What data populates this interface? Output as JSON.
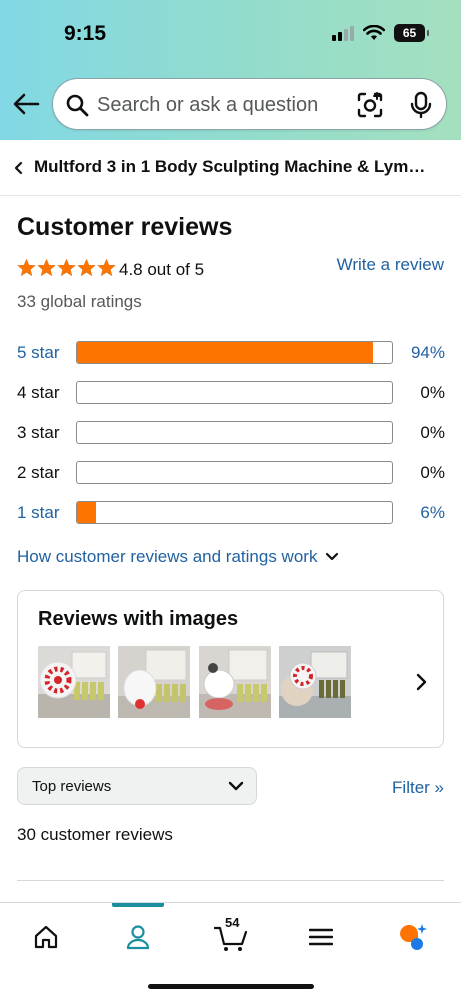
{
  "status_bar": {
    "time": "9:15",
    "battery": "65"
  },
  "search": {
    "placeholder": "Search or ask a question"
  },
  "breadcrumb": {
    "title": "Multford 3 in 1 Body Sculpting Machine & Lym…"
  },
  "reviews": {
    "heading": "Customer reviews",
    "rating_text": "4.8 out of 5",
    "stars": 4.8,
    "write_review": "Write a review",
    "global_ratings": "33 global ratings",
    "histogram": [
      {
        "label": "5 star",
        "percent_text": "94%",
        "fill": 0.94,
        "link": true
      },
      {
        "label": "4 star",
        "percent_text": "0%",
        "fill": 0,
        "link": false
      },
      {
        "label": "3 star",
        "percent_text": "0%",
        "fill": 0,
        "link": false
      },
      {
        "label": "2 star",
        "percent_text": "0%",
        "fill": 0,
        "link": false
      },
      {
        "label": "1 star",
        "percent_text": "6%",
        "fill": 0.06,
        "link": true
      }
    ],
    "how_link": "How customer reviews and ratings work",
    "images_title": "Reviews with images",
    "sort_selected": "Top reviews",
    "filter_link": "Filter »",
    "count_text": "30 customer reviews"
  },
  "bottom_nav": {
    "items": [
      "home-icon",
      "profile-icon",
      "cart-icon",
      "menu-icon",
      "rufus-icon"
    ],
    "cart_count": "54",
    "active": "profile-icon"
  },
  "colors": {
    "accent": "#ff7300",
    "link": "#2162a1",
    "nav_active": "#1a8fa0",
    "star": "#ff7300"
  }
}
